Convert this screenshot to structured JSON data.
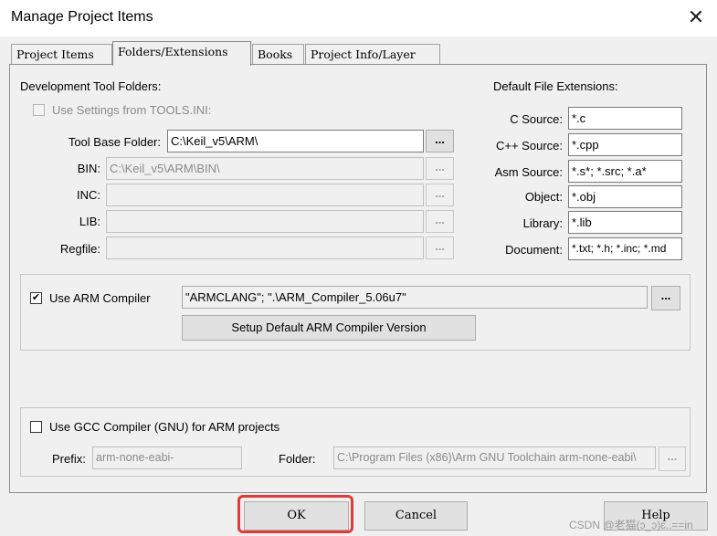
{
  "window": {
    "title": "Manage Project Items",
    "close_glyph": "✕"
  },
  "tabs": [
    {
      "label": "Project Items",
      "active": false
    },
    {
      "label": "Folders/Extensions",
      "active": true
    },
    {
      "label": "Books",
      "active": false
    },
    {
      "label": "Project Info/Layer",
      "active": false
    }
  ],
  "dev_tools": {
    "heading": "Development Tool Folders:",
    "use_settings_label": "Use Settings from TOOLS.INI:",
    "use_settings_checked": false,
    "tool_base": {
      "label": "Tool Base Folder:",
      "value": "C:\\Keil_v5\\ARM\\"
    },
    "bin": {
      "label": "BIN:",
      "value": "C:\\Keil_v5\\ARM\\BIN\\"
    },
    "inc": {
      "label": "INC:",
      "value": ""
    },
    "lib": {
      "label": "LIB:",
      "value": ""
    },
    "regfile": {
      "label": "Regfile:",
      "value": ""
    },
    "browse_label": "..."
  },
  "extensions": {
    "heading": "Default File Extensions:",
    "items": [
      {
        "label": "C Source:",
        "value": "*.c"
      },
      {
        "label": "C++ Source:",
        "value": "*.cpp"
      },
      {
        "label": "Asm Source:",
        "value": "*.s*; *.src; *.a*"
      },
      {
        "label": "Object:",
        "value": "*.obj"
      },
      {
        "label": "Library:",
        "value": "*.lib"
      },
      {
        "label": "Document:",
        "value": "*.txt; *.h; *.inc; *.md"
      }
    ]
  },
  "arm_compiler": {
    "checkbox_label": "Use ARM Compiler",
    "checked": true,
    "check_glyph": "✔",
    "value": "\"ARMCLANG\"; \".\\ARM_Compiler_5.06u7\"",
    "setup_button": "Setup Default ARM Compiler Version"
  },
  "gcc": {
    "checkbox_label": "Use GCC Compiler (GNU) for ARM projects",
    "checked": false,
    "prefix_label": "Prefix:",
    "prefix_value": "arm-none-eabi-",
    "folder_label": "Folder:",
    "folder_value": "C:\\Program Files (x86)\\Arm GNU Toolchain arm-none-eabi\\"
  },
  "footer": {
    "ok": "OK",
    "cancel": "Cancel",
    "help": "Help"
  },
  "watermark": "CSDN @老猫(ɔ_ɔ)ɛ..==in",
  "colors": {
    "highlight": "#e03a3a"
  }
}
